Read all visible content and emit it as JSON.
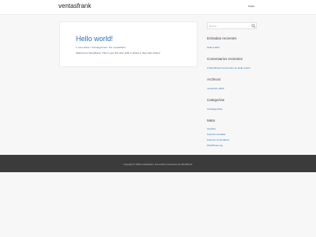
{
  "header": {
    "site_title": "ventasfrank",
    "menu_item": "Inicio"
  },
  "post": {
    "title": "Hello world!",
    "meta": "1 comentario / Uncategorized / Por ventasfrank",
    "excerpt": "Welcome to WordPress. This is your first post. Edit or delete it, then start writing!"
  },
  "sidebar": {
    "search_placeholder": "Buscar ...",
    "recent_posts": {
      "title": "Entradas recientes",
      "items": [
        "Hello world!"
      ]
    },
    "recent_comments": {
      "title": "Comentarios recientes",
      "author": "A WordPress Commenter",
      "connector": "en",
      "post": "Hello world!"
    },
    "archives": {
      "title": "Archivos",
      "items": [
        "noviembre 2020"
      ]
    },
    "categories": {
      "title": "Categorías",
      "items": [
        "Uncategorized"
      ]
    },
    "meta": {
      "title": "Meta",
      "items": [
        "Acceder",
        "Feed de entradas",
        "Feed de comentarios",
        "WordPress.org"
      ]
    }
  },
  "footer": {
    "text": "Copyright © 2020 ventasfrank | Tema Astra | Funciona con WordPress"
  },
  "colors": {
    "link": "#2a6ebb",
    "footer_bg": "#3b3b3b",
    "page_bg": "#f7f7f7"
  }
}
